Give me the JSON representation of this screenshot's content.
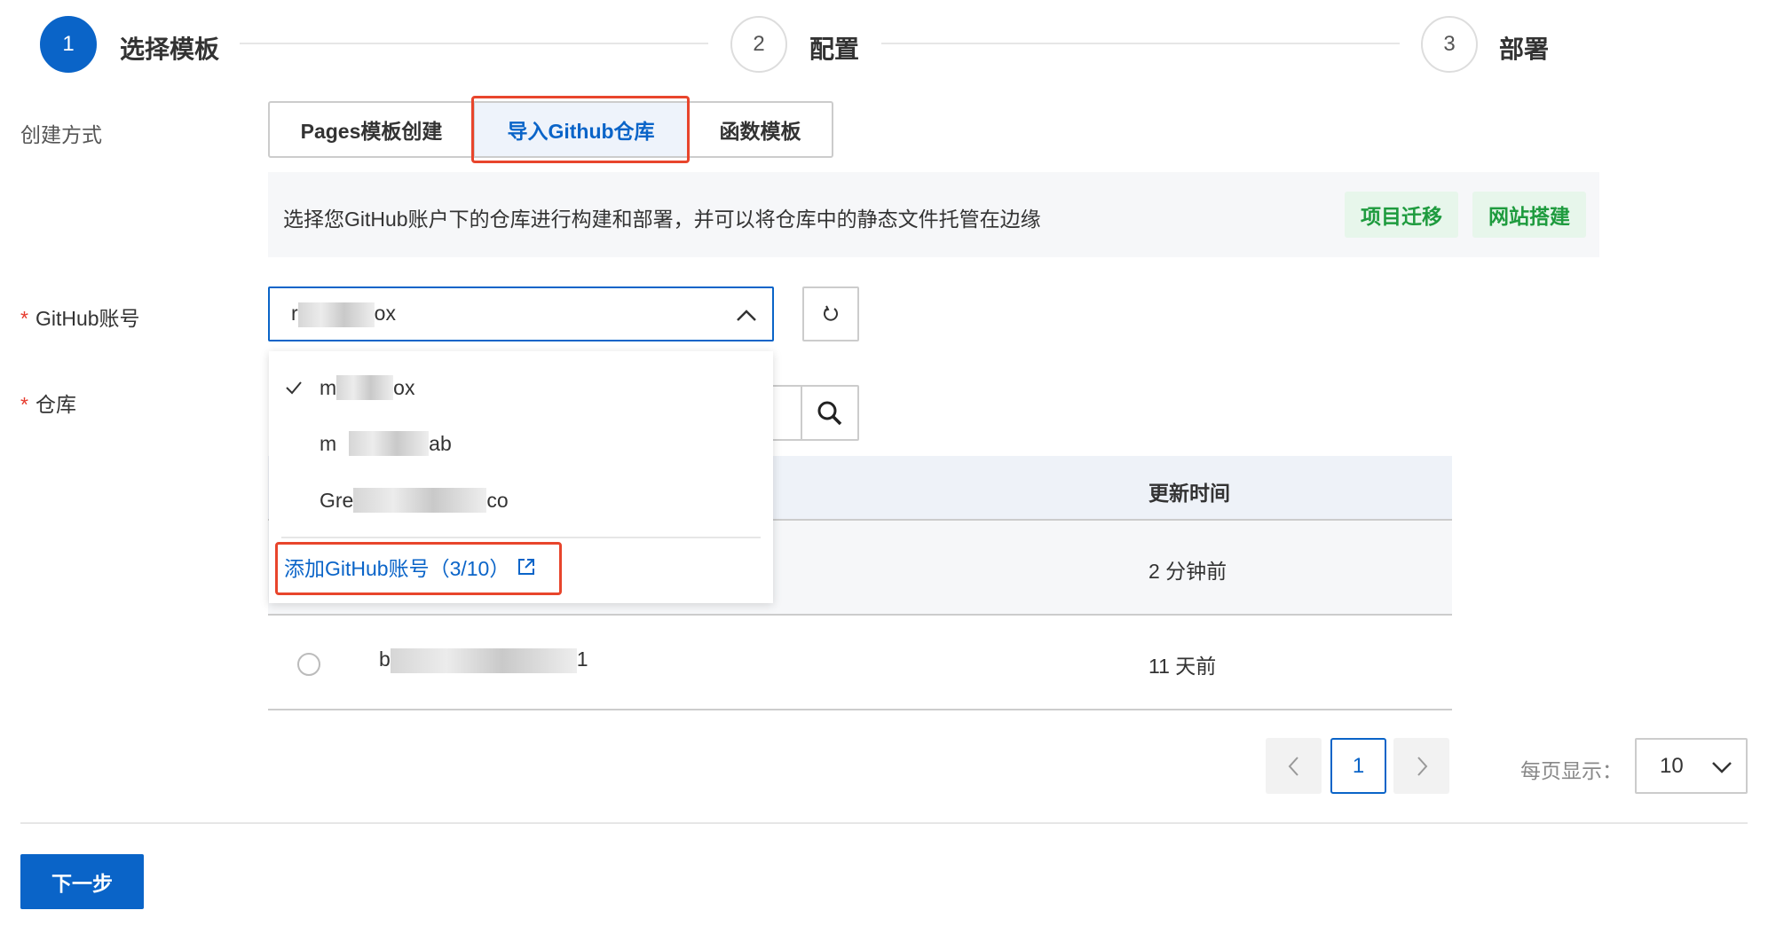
{
  "steps": [
    {
      "num": "1",
      "title": "选择模板"
    },
    {
      "num": "2",
      "title": "配置"
    },
    {
      "num": "3",
      "title": "部署"
    }
  ],
  "create_method": {
    "label": "创建方式",
    "tabs": [
      "Pages模板创建",
      "导入Github仓库",
      "函数模板"
    ],
    "selected": 1
  },
  "info": {
    "text": "选择您GitHub账户下的仓库进行构建和部署，并可以将仓库中的静态文件托管在边缘",
    "btn_migrate": "项目迁移",
    "btn_site": "网站搭建"
  },
  "github": {
    "label": "GitHub账号",
    "required": "*",
    "value_prefix": "r",
    "value_suffix": "ox"
  },
  "repo": {
    "label": "仓库",
    "required": "*"
  },
  "dropdown": {
    "options": [
      {
        "prefix": "m",
        "suffix": "ox",
        "checked": true
      },
      {
        "prefix": "m",
        "suffix": "ab",
        "checked": false
      },
      {
        "prefix": "Gre",
        "suffix": "co",
        "checked": false
      }
    ],
    "add_account": "添加GitHub账号（3/10）"
  },
  "table": {
    "col_time": "更新时间",
    "rows": [
      {
        "name_prefix": "",
        "name_suffix": "",
        "time": "2 分钟前"
      },
      {
        "name_prefix": "b",
        "name_suffix": "1",
        "time": "11 天前"
      }
    ]
  },
  "pagination": {
    "page": "1",
    "page_size_label": "每页显示：",
    "page_size": "10"
  },
  "footer": {
    "next": "下一步"
  },
  "colors": {
    "primary": "#0a64c8",
    "highlight": "#e8452c",
    "green": "#1e9b3e"
  }
}
